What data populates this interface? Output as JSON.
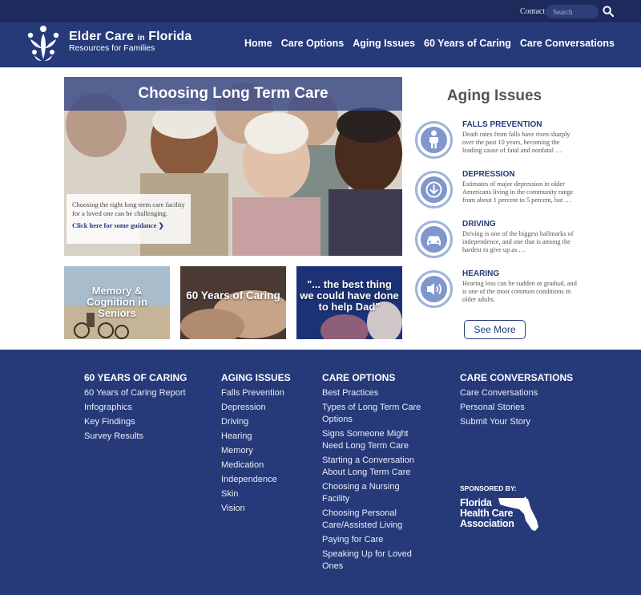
{
  "topbar": {
    "contact": "Contact",
    "search_placeholder": "Search"
  },
  "header": {
    "title_main": "Elder Care ",
    "title_in": "in",
    "title_end": " Florida",
    "subtitle": "Resources for Families",
    "nav": [
      "Home",
      "Care Options",
      "Aging Issues",
      "60 Years of Caring",
      "Care Conversations"
    ]
  },
  "hero": {
    "title": "Choosing Long Term Care",
    "caption": "Choosing the right long term care facility for a loved one can be challenging.",
    "link": "Click here for some guidance ❯"
  },
  "tiles": [
    {
      "label": "Memory & Cognition in Seniors"
    },
    {
      "label": "60 Years of Caring"
    },
    {
      "label": "\"... the best thing we could have done to help Dad\""
    }
  ],
  "aging": {
    "title": "Aging Issues",
    "items": [
      {
        "heading": "FALLS PREVENTION",
        "text": "Death rates from falls have risen sharply over the past 10 years, becoming the leading cause of fatal and nonfatal …",
        "icon": "person-icon"
      },
      {
        "heading": "DEPRESSION",
        "text": "Estimates of major depression in older Americans living in the community range from about 1 percent to 5 percent, but …",
        "icon": "down-arrow-icon"
      },
      {
        "heading": "DRIVING",
        "text": "Driving is one of the biggest hallmarks of independence, and one that is among the hardest to give up as …",
        "icon": "car-icon"
      },
      {
        "heading": "HEARING",
        "text": "Hearing loss can be sudden or gradual, and is one of the most common conditions in older adults.",
        "icon": "speaker-icon"
      }
    ],
    "see_more": "See More"
  },
  "footer": {
    "columns": [
      {
        "heading": "60 YEARS OF CARING",
        "links": [
          "60 Years of Caring Report",
          "Infographics",
          "Key Findings",
          "Survey Results"
        ]
      },
      {
        "heading": "AGING ISSUES",
        "links": [
          "Falls Prevention",
          "Depression",
          "Driving",
          "Hearing",
          "Memory",
          "Medication",
          "Independence",
          "Skin",
          "Vision"
        ]
      },
      {
        "heading": "CARE OPTIONS",
        "links": [
          "Best Practices",
          "Types of Long Term Care Options",
          "Signs Someone Might Need Long Term Care",
          "Starting a Conversation About Long Term Care",
          "Choosing a Nursing Facility",
          "Choosing Personal Care/Assisted Living",
          "Paying for Care",
          "Speaking Up for Loved Ones"
        ]
      },
      {
        "heading": "CARE CONVERSATIONS",
        "links": [
          "Care Conversations",
          "Personal Stories",
          "Submit Your Story"
        ]
      }
    ],
    "sponsor_label": "SPONSORED BY:",
    "sponsor_name": "Florida\nHealth Care\nAssociation"
  },
  "colors": {
    "brand_dark": "#1c2a5c",
    "brand": "#263a7a",
    "icon_ring": "#9fb3da"
  }
}
